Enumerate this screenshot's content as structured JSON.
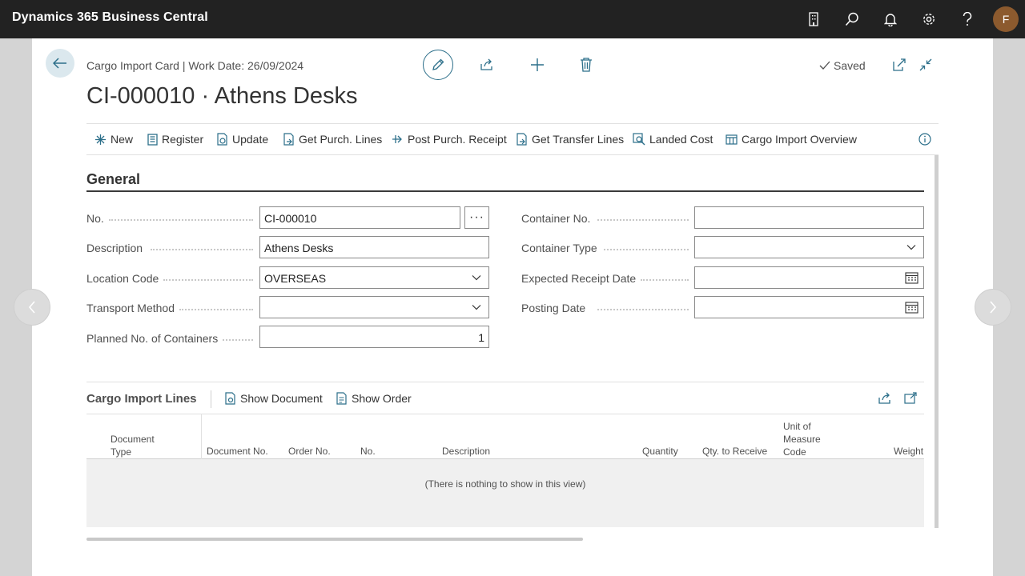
{
  "app": {
    "title": "Dynamics 365 Business Central",
    "avatar_initial": "F"
  },
  "header": {
    "breadcrumb": "Cargo Import Card | Work Date: 26/09/2024",
    "title": "CI-000010 · Athens Desks",
    "saved_label": "Saved"
  },
  "actions": [
    {
      "label": "New",
      "icon": "new-icon"
    },
    {
      "label": "Register",
      "icon": "register-icon"
    },
    {
      "label": "Update",
      "icon": "update-icon"
    },
    {
      "label": "Get Purch. Lines",
      "icon": "get-lines-icon"
    },
    {
      "label": "Post Purch. Receipt",
      "icon": "post-icon"
    },
    {
      "label": "Get Transfer Lines",
      "icon": "transfer-icon"
    },
    {
      "label": "Landed Cost",
      "icon": "landed-cost-icon"
    },
    {
      "label": "Cargo Import Overview",
      "icon": "overview-icon"
    }
  ],
  "general": {
    "title": "General",
    "no_label": "No.",
    "no_value": "CI-000010",
    "assist_label": "···",
    "description_label": "Description",
    "description_value": "Athens Desks",
    "location_label": "Location Code",
    "location_value": "OVERSEAS",
    "transport_label": "Transport Method",
    "transport_value": "",
    "planned_label": "Planned No. of Containers",
    "planned_value": "1",
    "container_no_label": "Container No.",
    "container_no_value": "",
    "container_type_label": "Container Type",
    "container_type_value": "",
    "expected_label": "Expected Receipt Date",
    "expected_value": "",
    "posting_label": "Posting Date",
    "posting_value": ""
  },
  "lines": {
    "title": "Cargo Import Lines",
    "show_document": "Show Document",
    "show_order": "Show Order",
    "columns": {
      "document_type_1": "Document",
      "document_type_2": "Type",
      "document_no": "Document No.",
      "order_no": "Order No.",
      "no": "No.",
      "description": "Description",
      "quantity": "Quantity",
      "qty_to_receive": "Qty. to Receive",
      "uom_1": "Unit of",
      "uom_2": "Measure",
      "uom_3": "Code",
      "weight": "Weight"
    },
    "empty_message": "(There is nothing to show in this view)"
  },
  "colors": {
    "topbar": "#222222",
    "accent": "#2c6f8a",
    "avatar": "#8c5a2e"
  }
}
